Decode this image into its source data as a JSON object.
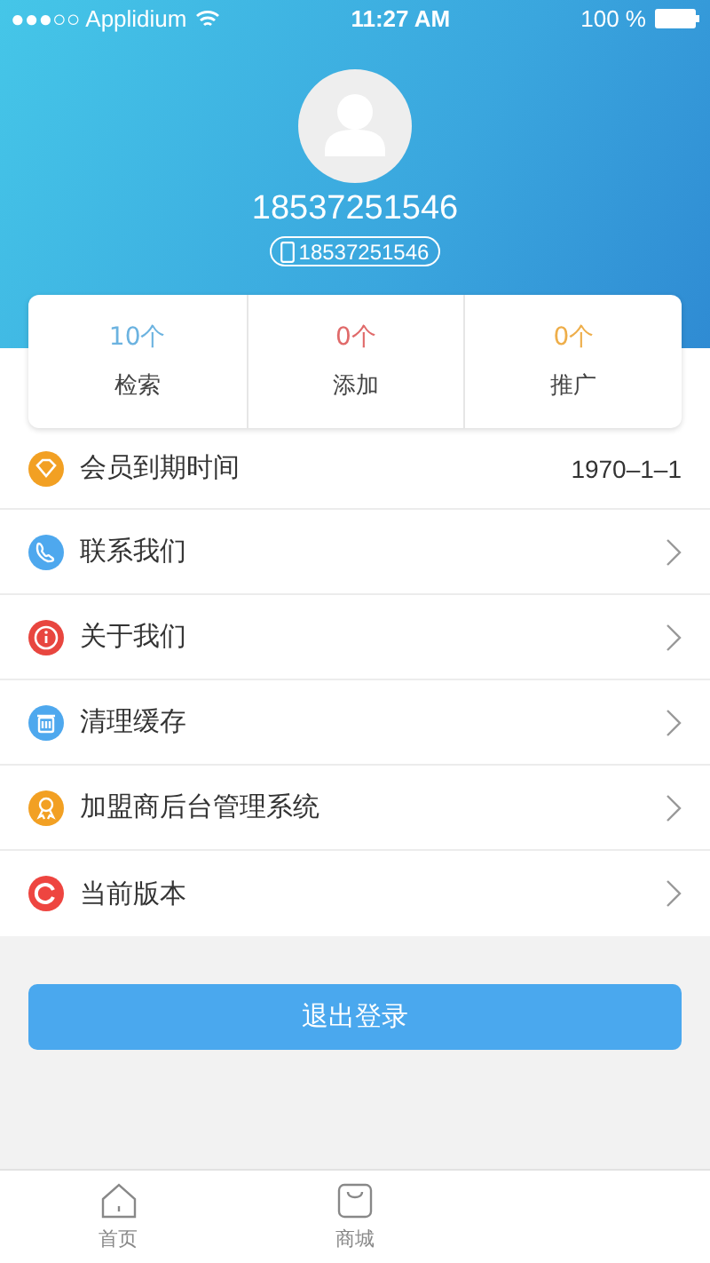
{
  "status_bar": {
    "carrier": "●●●○○ Applidium",
    "time": "11:27 AM",
    "battery": "100 %"
  },
  "profile": {
    "name": "18537251546",
    "phone": "18537251546"
  },
  "stats": [
    {
      "value": "10个",
      "label": "检索",
      "color": "#6cb3e0"
    },
    {
      "value": "0个",
      "label": "添加",
      "color": "#e06a6a"
    },
    {
      "value": "0个",
      "label": "推广",
      "color": "#eeae4a"
    }
  ],
  "menu": [
    {
      "kind": "diamond",
      "color": "#f2a023",
      "label": "会员到期时间",
      "value": "1970–1–1",
      "arrow": false
    },
    {
      "kind": "phone",
      "color": "#4ea8ee",
      "label": "联系我们",
      "arrow": true
    },
    {
      "kind": "info",
      "color": "#e8463f",
      "label": "关于我们",
      "arrow": true
    },
    {
      "kind": "trash",
      "color": "#4ea8ee",
      "label": "清理缓存",
      "arrow": true
    },
    {
      "kind": "medal",
      "color": "#f2a023",
      "label": "加盟商后台管理系统",
      "arrow": true
    },
    {
      "kind": "refresh",
      "color": "#ee4540",
      "label": "当前版本",
      "arrow": true
    }
  ],
  "logout_button": "退出登录",
  "tab_bar": [
    {
      "kind": "home",
      "label": "首页"
    },
    {
      "kind": "bag",
      "label": "商城"
    }
  ]
}
